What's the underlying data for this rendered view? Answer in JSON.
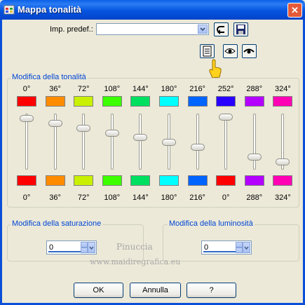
{
  "window": {
    "title": "Mappa tonalità",
    "close_glyph": "✕"
  },
  "preset": {
    "label": "Imp. predef.:",
    "value": ""
  },
  "hue_group": {
    "legend": "Modifica della tonalità",
    "columns": [
      {
        "top_label": "0°",
        "top_color": "#ff0000",
        "bottom_color": "#ff0000",
        "bottom_label": "0°",
        "level": 0.92
      },
      {
        "top_label": "36°",
        "top_color": "#ff8c00",
        "bottom_color": "#ff8c00",
        "bottom_label": "36°",
        "level": 0.83
      },
      {
        "top_label": "72°",
        "top_color": "#c8f000",
        "bottom_color": "#c8f000",
        "bottom_label": "72°",
        "level": 0.74
      },
      {
        "top_label": "108°",
        "top_color": "#3cff00",
        "bottom_color": "#3cff00",
        "bottom_label": "108°",
        "level": 0.65
      },
      {
        "top_label": "144°",
        "top_color": "#00e060",
        "bottom_color": "#00e060",
        "bottom_label": "144°",
        "level": 0.56
      },
      {
        "top_label": "180°",
        "top_color": "#00ffff",
        "bottom_color": "#00ffff",
        "bottom_label": "180°",
        "level": 0.47
      },
      {
        "top_label": "216°",
        "top_color": "#0064ff",
        "bottom_color": "#0064ff",
        "bottom_label": "216°",
        "level": 0.38
      },
      {
        "top_label": "252°",
        "top_color": "#2800ff",
        "bottom_color": "#ff0000",
        "bottom_label": "0°",
        "level": 0.95
      },
      {
        "top_label": "288°",
        "top_color": "#b400ff",
        "bottom_color": "#b400ff",
        "bottom_label": "288°",
        "level": 0.2
      },
      {
        "top_label": "324°",
        "top_color": "#ff00b4",
        "bottom_color": "#ff00b4",
        "bottom_label": "324°",
        "level": 0.11
      }
    ]
  },
  "saturation": {
    "legend": "Modifica della saturazione",
    "value": "0"
  },
  "brightness": {
    "legend": "Modifica della luminosità",
    "value": "0"
  },
  "buttons": {
    "ok": "OK",
    "cancel": "Annulla",
    "help": "?"
  },
  "watermark": {
    "line1": "Pinuccia",
    "line2": "www.maidiregrafica.eu"
  }
}
